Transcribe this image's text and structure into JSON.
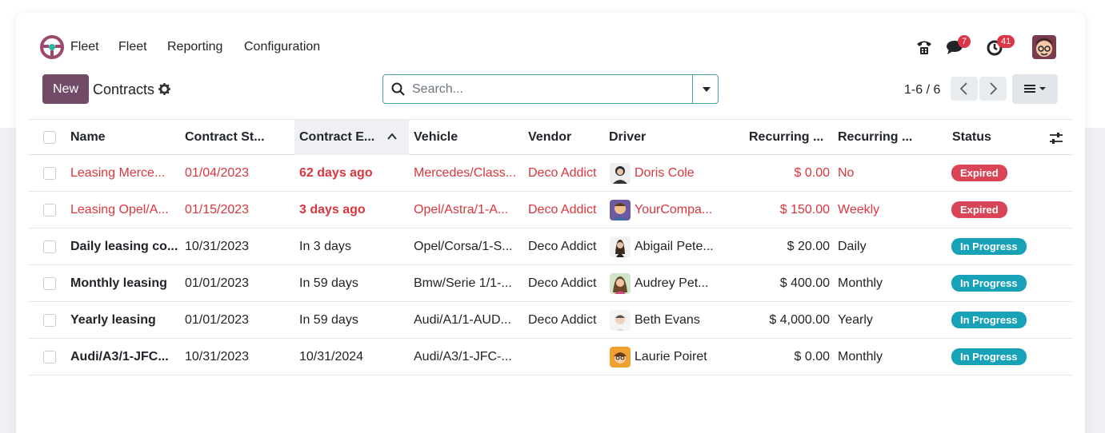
{
  "navbar": {
    "app_name": "Fleet",
    "menu": [
      "Fleet",
      "Reporting",
      "Configuration"
    ],
    "messages_count": "7",
    "activities_count": "41"
  },
  "control": {
    "new_label": "New",
    "title": "Contracts",
    "search_placeholder": "Search...",
    "pager": "1-6 / 6"
  },
  "columns": [
    "Name",
    "Contract St...",
    "Contract E...",
    "Vehicle",
    "Vendor",
    "Driver",
    "Recurring ...",
    "Recurring ...",
    "Status"
  ],
  "rows": [
    {
      "name": "Leasing Merce...",
      "start": "01/04/2023",
      "end": "62 days ago",
      "vehicle": "Mercedes/Class...",
      "vendor": "Deco Addict",
      "driver": "Doris Cole",
      "cost": "$ 0.00",
      "freq": "No",
      "status": "Expired",
      "danger": true,
      "bold": false
    },
    {
      "name": "Leasing Opel/A...",
      "start": "01/15/2023",
      "end": "3 days ago",
      "vehicle": "Opel/Astra/1-A...",
      "vendor": "Deco Addict",
      "driver": "YourCompa...",
      "cost": "$ 150.00",
      "freq": "Weekly",
      "status": "Expired",
      "danger": true,
      "bold": false
    },
    {
      "name": "Daily leasing co...",
      "start": "10/31/2023",
      "end": "In 3 days",
      "vehicle": "Opel/Corsa/1-S...",
      "vendor": "Deco Addict",
      "driver": "Abigail Pete...",
      "cost": "$ 20.00",
      "freq": "Daily",
      "status": "In Progress",
      "danger": false,
      "bold": true
    },
    {
      "name": "Monthly leasing",
      "start": "01/01/2023",
      "end": "In 59 days",
      "vehicle": "Bmw/Serie 1/1-...",
      "vendor": "Deco Addict",
      "driver": "Audrey Pet...",
      "cost": "$ 400.00",
      "freq": "Monthly",
      "status": "In Progress",
      "danger": false,
      "bold": true
    },
    {
      "name": "Yearly leasing",
      "start": "01/01/2023",
      "end": "In 59 days",
      "vehicle": "Audi/A1/1-AUD...",
      "vendor": "Deco Addict",
      "driver": "Beth Evans",
      "cost": "$ 4,000.00",
      "freq": "Yearly",
      "status": "In Progress",
      "danger": false,
      "bold": true
    },
    {
      "name": "Audi/A3/1-JFC...",
      "start": "10/31/2023",
      "end": "10/31/2024",
      "vehicle": "Audi/A3/1-JFC-...",
      "vendor": "",
      "driver": "Laurie Poiret",
      "cost": "$ 0.00",
      "freq": "Monthly",
      "status": "In Progress",
      "danger": false,
      "bold": true
    }
  ],
  "colors": {
    "brand": "#714b67",
    "danger": "#d9363e",
    "expired_badge": "#d94556",
    "progress_badge": "#17a2b8"
  }
}
